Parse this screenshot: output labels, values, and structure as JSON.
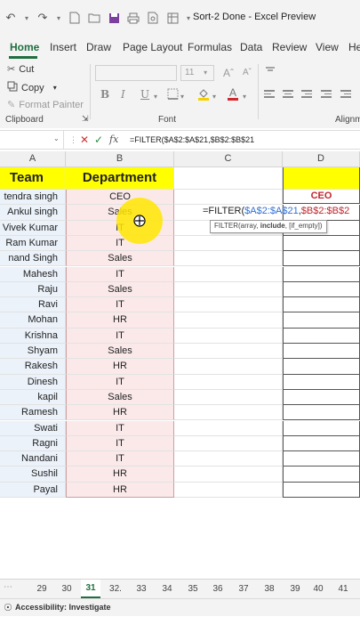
{
  "window": {
    "title": "Sort-2 Done - Excel Preview"
  },
  "tabs": [
    "Home",
    "Insert",
    "Draw",
    "Page Layout",
    "Formulas",
    "Data",
    "Review",
    "View",
    "He"
  ],
  "ribbon": {
    "clipboard": {
      "cut": "Cut",
      "copy": "Copy",
      "format_painter": "Format Painter",
      "label": "Clipboard"
    },
    "font": {
      "size": "11",
      "label": "Font",
      "bold": "B",
      "italic": "I",
      "underline": "U"
    },
    "alignment_label": "Alignm"
  },
  "formula_bar": {
    "formula": "=FILTER($A$2:$A$21,$B$2:$B$21"
  },
  "columns": {
    "A": "A",
    "B": "B",
    "C": "C",
    "D": "D"
  },
  "headers": {
    "team": "Team",
    "department": "Department",
    "d1": "CEO"
  },
  "rows": [
    {
      "name": "tendra singh",
      "dept": "CEO"
    },
    {
      "name": "Ankul singh",
      "dept": "Sales"
    },
    {
      "name": "Vivek Kumar",
      "dept": "IT"
    },
    {
      "name": "Ram Kumar",
      "dept": "IT"
    },
    {
      "name": "nand Singh",
      "dept": "Sales"
    },
    {
      "name": "Mahesh",
      "dept": "IT"
    },
    {
      "name": "Raju",
      "dept": "Sales"
    },
    {
      "name": "Ravi",
      "dept": "IT"
    },
    {
      "name": "Mohan",
      "dept": "HR"
    },
    {
      "name": "Krishna",
      "dept": "IT"
    },
    {
      "name": "Shyam",
      "dept": "Sales"
    },
    {
      "name": "Rakesh",
      "dept": "HR"
    },
    {
      "name": "Dinesh",
      "dept": "IT"
    },
    {
      "name": "kapil",
      "dept": "Sales"
    },
    {
      "name": "Ramesh",
      "dept": "HR"
    },
    {
      "name": "Swati",
      "dept": "IT"
    },
    {
      "name": "Ragni",
      "dept": "IT"
    },
    {
      "name": "Nandani",
      "dept": "IT"
    },
    {
      "name": "Sushil",
      "dept": "HR"
    },
    {
      "name": "Payal",
      "dept": "HR"
    }
  ],
  "cell_formula": {
    "prefix": "=FILTER(",
    "range_a": "$A$2:$A$21",
    "comma": ",",
    "range_b": "$B$2:$B$2"
  },
  "tooltip": {
    "pre": "FILTER(array, ",
    "bold": "include",
    "post": ", [if_empty])"
  },
  "sheet_tabs": [
    "29",
    "30",
    "31",
    "32.",
    "33",
    "34",
    "35",
    "36",
    "37",
    "38",
    "39",
    "40",
    "41"
  ],
  "active_sheet": "31",
  "status": {
    "accessibility": "Accessibility: Investigate"
  },
  "colors": {
    "accent": "#1f6f3f",
    "header_fill": "#ffff00",
    "ceo_text": "#c0262d",
    "team_fill": "#ebf2fa",
    "dept_fill": "#fbe9ea"
  }
}
